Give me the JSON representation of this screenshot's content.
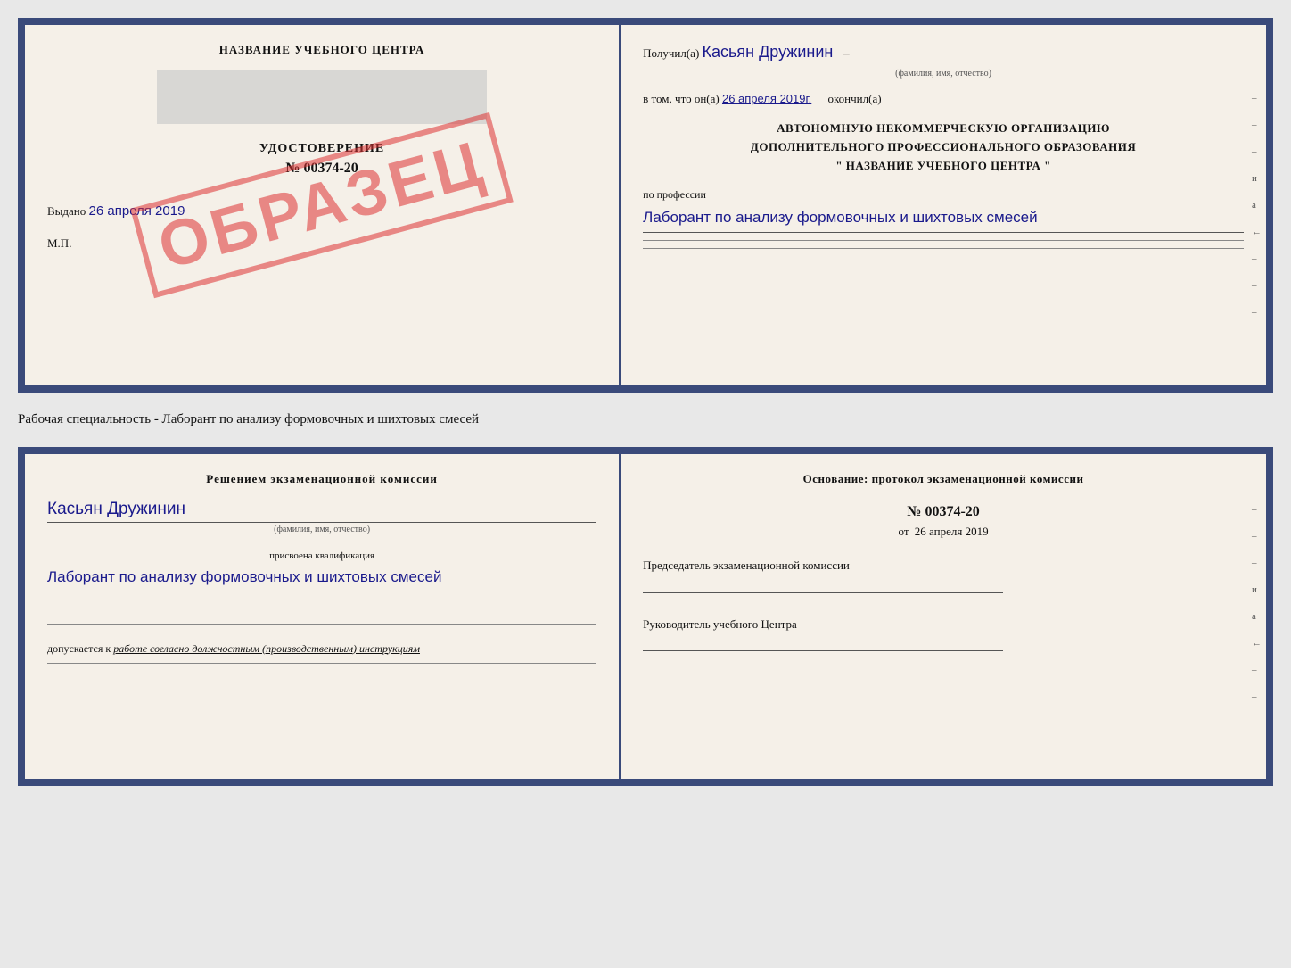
{
  "top_doc": {
    "left": {
      "center_title": "НАЗВАНИЕ УЧЕБНОГО ЦЕНТРА",
      "cert_label": "УДОСТОВЕРЕНИЕ",
      "cert_number": "№ 00374-20",
      "vydano_prefix": "Выдано",
      "vydano_date": "26 апреля 2019",
      "mp": "М.П.",
      "obrazets": "ОБРАЗЕЦ"
    },
    "right": {
      "poluchil_prefix": "Получил(а)",
      "poluchil_name": "Касьян Дружинин",
      "fio_hint": "(фамилия, имя, отчество)",
      "vtom_prefix": "в том, что он(а)",
      "vtom_date": "26 апреля 2019г.",
      "okoncil": "окончил(а)",
      "org_line1": "АВТОНОМНУЮ НЕКОММЕРЧЕСКУЮ ОРГАНИЗАЦИЮ",
      "org_line2": "ДОПОЛНИТЕЛЬНОГО ПРОФЕССИОНАЛЬНОГО ОБРАЗОВАНИЯ",
      "org_name": "\" НАЗВАНИЕ УЧЕБНОГО ЦЕНТРА \"",
      "profession_prefix": "по профессии",
      "profession_handwrite": "Лаборант по анализу формовочных и шихтовых смесей",
      "side_marks": [
        "–",
        "–",
        "–",
        "и",
        "а",
        "←",
        "–",
        "–",
        "–"
      ]
    }
  },
  "specialty_line": "Рабочая специальность - Лаборант по анализу формовочных и шихтовых смесей",
  "bottom_doc": {
    "left": {
      "reshenie_title": "Решением экзаменационной комиссии",
      "name_handwrite": "Касьян Дружинин",
      "fio_hint": "(фамилия, имя, отчество)",
      "kvalif_label": "присвоена квалификация",
      "kvalif_handwrite": "Лаборант по анализу формовочных и шихтовых смесей",
      "dopusk_prefix": "допускается к",
      "dopusk_italic": "работе согласно должностным (производственным) инструкциям"
    },
    "right": {
      "osnovanie_title": "Основание: протокол экзаменационной комиссии",
      "protocol_number": "№ 00374-20",
      "ot_prefix": "от",
      "ot_date": "26 апреля 2019",
      "predsedatel_label": "Председатель экзаменационной комиссии",
      "ruk_label": "Руководитель учебного Центра",
      "side_marks": [
        "–",
        "–",
        "–",
        "и",
        "а",
        "←",
        "–",
        "–",
        "–"
      ]
    }
  }
}
